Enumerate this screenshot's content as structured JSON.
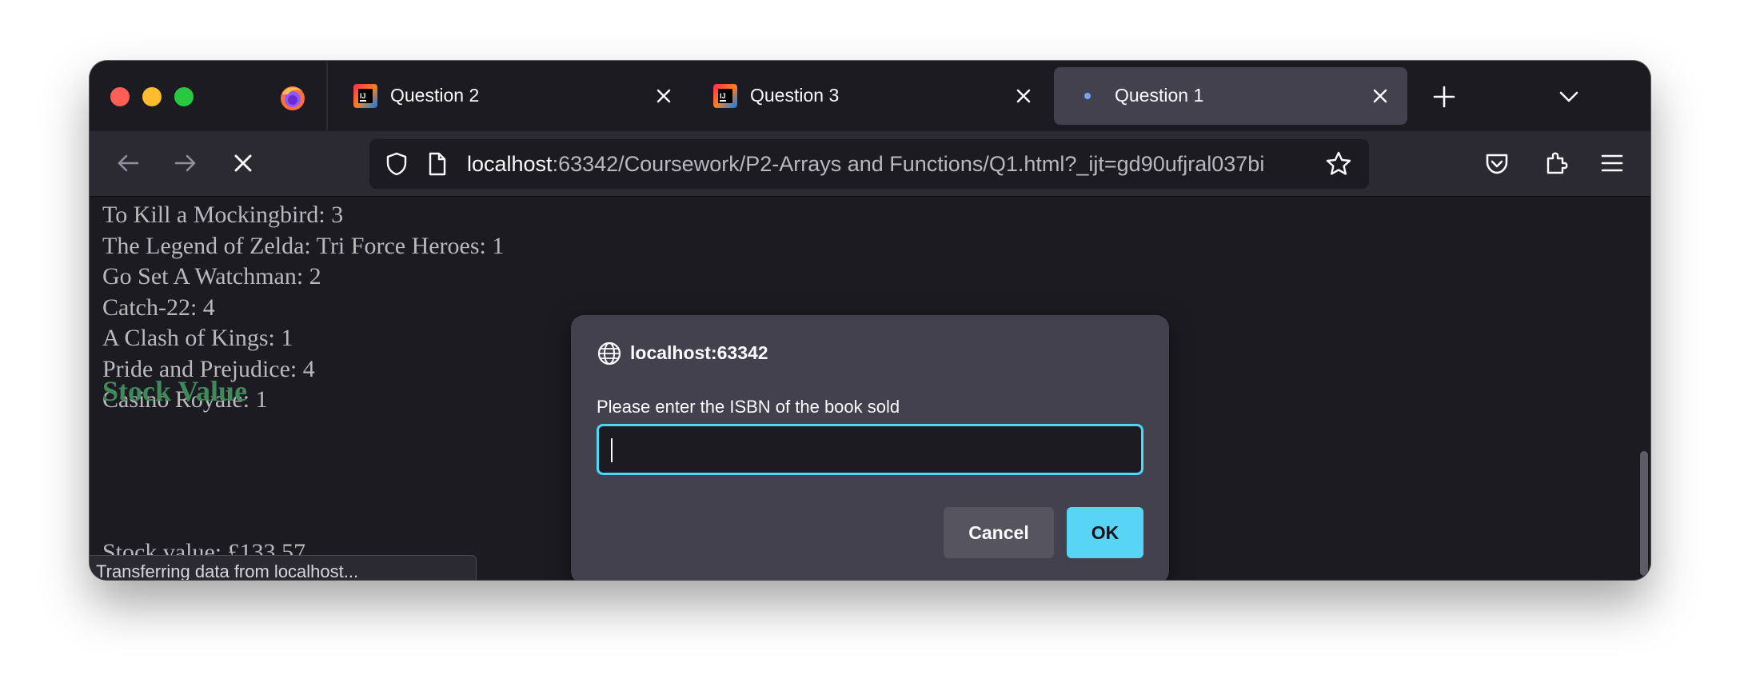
{
  "tabs": [
    {
      "title": "Question 2",
      "icon": "intellij-icon"
    },
    {
      "title": "Question 3",
      "icon": "intellij-icon"
    },
    {
      "title": "Question 1",
      "icon": "loading-dot",
      "active": true
    }
  ],
  "nav": {
    "url_host": "localhost",
    "url_rest": ":63342/Coursework/P2-Arrays and Functions/Q1.html?_ijt=gd90ufjral037bi"
  },
  "content": {
    "partial_line": "Casino Royale: 1",
    "books": [
      "To Kill a Mockingbird: 3",
      "The Legend of Zelda: Tri Force Heroes: 1",
      "Go Set A Watchman: 2",
      "Catch-22: 4",
      "A Clash of Kings: 1",
      "Pride and Prejudice: 4",
      "Casino Royale: 1"
    ],
    "stock_heading": "Stock Value",
    "stock_value_line": "Stock value: £133.57"
  },
  "status": "Transferring data from localhost...",
  "dialog": {
    "origin": "localhost:63342",
    "message": "Please enter the ISBN of the book sold",
    "input_value": "",
    "cancel_label": "Cancel",
    "ok_label": "OK"
  },
  "colors": {
    "accent": "#58d4f4",
    "heading": "#3f8a5a",
    "window_bg": "#1c1b22",
    "toolbar_bg": "#2b2a33"
  }
}
